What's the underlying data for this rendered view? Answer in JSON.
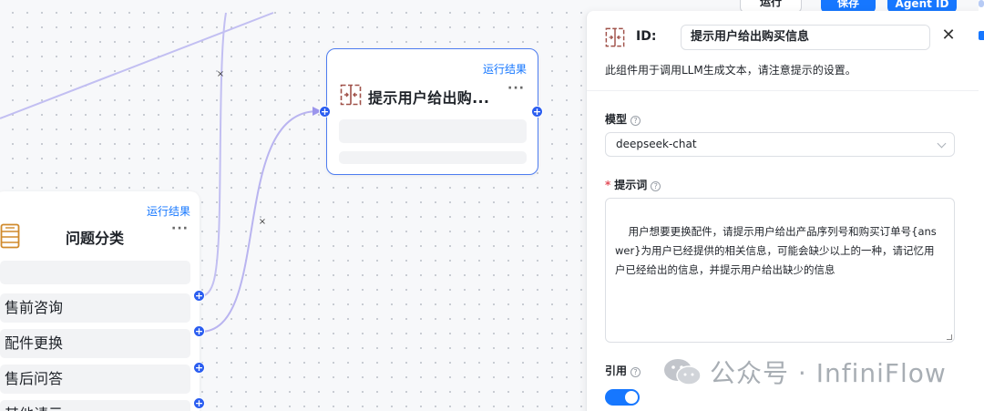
{
  "toolbar": {
    "run_label": "运行",
    "save_label": "保存",
    "agent_label": "Agent ID"
  },
  "generate_node": {
    "run_result_label": "运行结果",
    "title": "提示用户给出购...",
    "icon": "generate-icon",
    "more": "···"
  },
  "categorize_node": {
    "run_result_label": "运行结果",
    "title": "问题分类",
    "icon": "categorize-icon",
    "more": "···",
    "items": [
      {
        "label": "售前咨询"
      },
      {
        "label": "配件更换"
      },
      {
        "label": "售后问答"
      },
      {
        "label": "其他请示"
      }
    ]
  },
  "edge_delete_symbol": "×",
  "port_symbol": "+",
  "panel": {
    "id_label": "ID:",
    "id_value": "提示用户给出购买信息",
    "close_symbol": "✕",
    "description": "此组件用于调用LLM生成文本，请注意提示的设置。",
    "model_label": "模型",
    "model_value": "deepseek-chat",
    "prompt_label": "提示词",
    "prompt_required": "*",
    "prompt_value": "用户想要更换配件，请提示用户给出产品序列号和购买订单号{answer}为用户已经提供的相关信息，可能会缺少以上的一种，请记忆用户已经给出的信息，并提示用户给出缺少的信息",
    "quote_label": "引用",
    "quote_enabled": true,
    "help_symbol": "?"
  },
  "watermark": {
    "text": "公众号 · InfiniFlow",
    "icon": "wechat-icon"
  },
  "colors": {
    "accent": "#1677ff",
    "edge": "#b9b4f0",
    "port": "#2a5df0"
  }
}
